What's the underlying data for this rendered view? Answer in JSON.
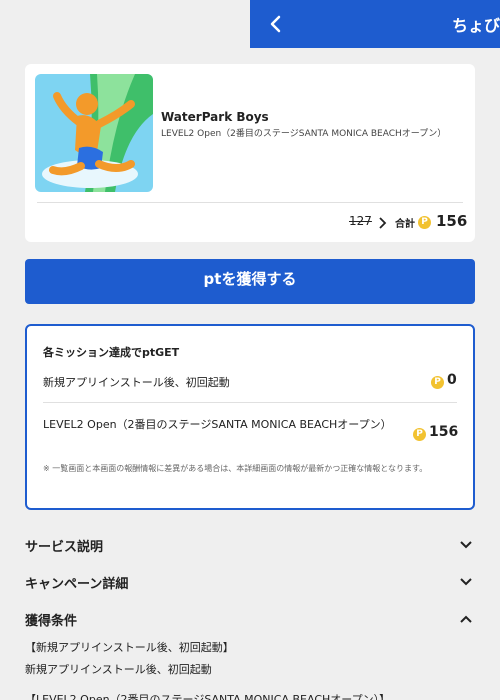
{
  "header": {
    "back_icon": "chevron-left-icon",
    "title": "ちょび",
    "color": "#1e5ccf"
  },
  "app": {
    "name": "WaterPark Boys",
    "description": "LEVEL2 Open（2番目のステージSANTA MONICA BEACHオープン）",
    "old_points": "127",
    "total_label": "合計",
    "total_points": "156",
    "coin_symbol": "P"
  },
  "cta": {
    "label": "ptを獲得する"
  },
  "missions": {
    "title": "各ミッション達成でptGET",
    "items": [
      {
        "label": "新規アプリインストール後、初回起動",
        "points": "0"
      },
      {
        "label": "LEVEL2 Open（2番目のステージSANTA MONICA BEACHオープン）",
        "points": "156"
      }
    ],
    "note": "※ 一覧画面と本画面の報酬情報に差異がある場合は、本詳細画面の情報が最新かつ正確な情報となります。"
  },
  "sections": [
    {
      "title": "サービス説明",
      "state": "collapsed"
    },
    {
      "title": "キャンペーン詳細",
      "state": "collapsed"
    },
    {
      "title": "獲得条件",
      "state": "expanded"
    }
  ],
  "conditions": [
    "【新規アプリインストール後、初回起動】",
    "新規アプリインストール後、初回起動",
    "【LEVEL2 Open（2番目のステージSANTA MONICA BEACHオープン）】"
  ],
  "colors": {
    "accent": "#1e5ccf",
    "coin": "#f2c230",
    "background": "#efefef"
  }
}
